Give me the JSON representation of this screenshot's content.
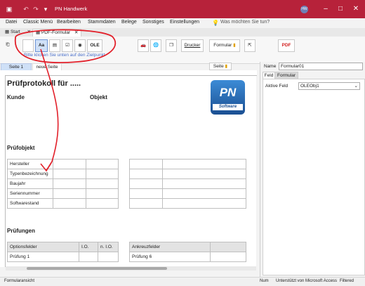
{
  "window": {
    "title": "PN Handwerk",
    "user_initials": "HW"
  },
  "menu": {
    "items": [
      "Datei",
      "Classic Menü",
      "Bearbeiten",
      "Stammdaten",
      "Belege",
      "Sonstiges",
      "Einstellungen"
    ],
    "search_placeholder": "Was möchten Sie tun?"
  },
  "tabs": {
    "start": "Start",
    "form": "PDF-Formular"
  },
  "ribbon": {
    "control_labels": [
      "Aa",
      "OLE"
    ],
    "hint": "Bitte klicken Sie unten auf den Zielpunkt",
    "drucker": "Drucker",
    "formular": "Formular",
    "pdf": "PDF"
  },
  "pages": {
    "tab1": "Seite 1",
    "tab2": "neue Seite",
    "seite_label": "Seite"
  },
  "form": {
    "title": "Prüfprotokoll für .....",
    "kunde": "Kunde",
    "objekt": "Objekt",
    "logo_text_top": "PN",
    "logo_text_bottom": "Software",
    "pruefobjekt": "Prüfobjekt",
    "object_rows": [
      "Hersteller",
      "Typenbezeichnung",
      "Baujahr",
      "Seriennummer",
      "Softwarestand"
    ],
    "pruefungen": "Prüfungen",
    "left_table_headers": [
      "Optionsfelder",
      "I.O.",
      "n. I.O."
    ],
    "left_table_row": "Prüfung 1",
    "right_table_header": "Ankreuzfelder",
    "right_table_row": "Prüfung 6"
  },
  "panel": {
    "name_label": "Name",
    "name_value": "Formular01",
    "tab_feld": "Feld",
    "tab_formular": "Formular",
    "aktives_feld_label": "Aktive Feld",
    "aktives_feld_value": "OLEObj1"
  },
  "status": {
    "left": "Formularansicht",
    "num": "Num",
    "support": "Unterstützt von Microsoft Access",
    "filtered": "Filtered"
  },
  "colors": {
    "titlebar": "#b7223a",
    "annotation": "#e2202a",
    "hint": "#4a6fc9"
  }
}
